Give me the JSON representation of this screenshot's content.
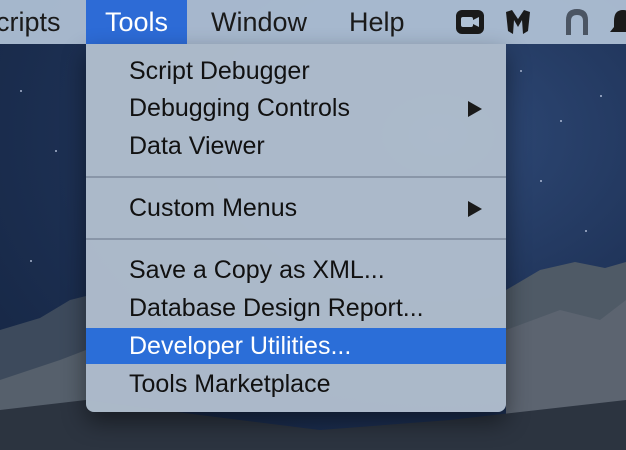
{
  "menubar": {
    "items": [
      {
        "label": "cripts"
      },
      {
        "label": "Tools"
      },
      {
        "label": "Window"
      },
      {
        "label": "Help"
      }
    ],
    "tray_icons": [
      "video-camera-icon",
      "malwarebytes-icon",
      "arch-icon",
      "notification-bell-icon"
    ]
  },
  "tools_menu": {
    "items": [
      {
        "label": "Script Debugger"
      },
      {
        "label": "Debugging Controls"
      },
      {
        "label": "Data Viewer"
      },
      {
        "label": "Custom Menus"
      },
      {
        "label": "Save a Copy as XML..."
      },
      {
        "label": "Database Design Report..."
      },
      {
        "label": "Developer Utilities..."
      },
      {
        "label": "Tools Marketplace"
      }
    ]
  },
  "colors": {
    "accent": "#2b6ed8",
    "menubar_bg": "#b0c2d6",
    "menu_bg": "#b1bece"
  }
}
